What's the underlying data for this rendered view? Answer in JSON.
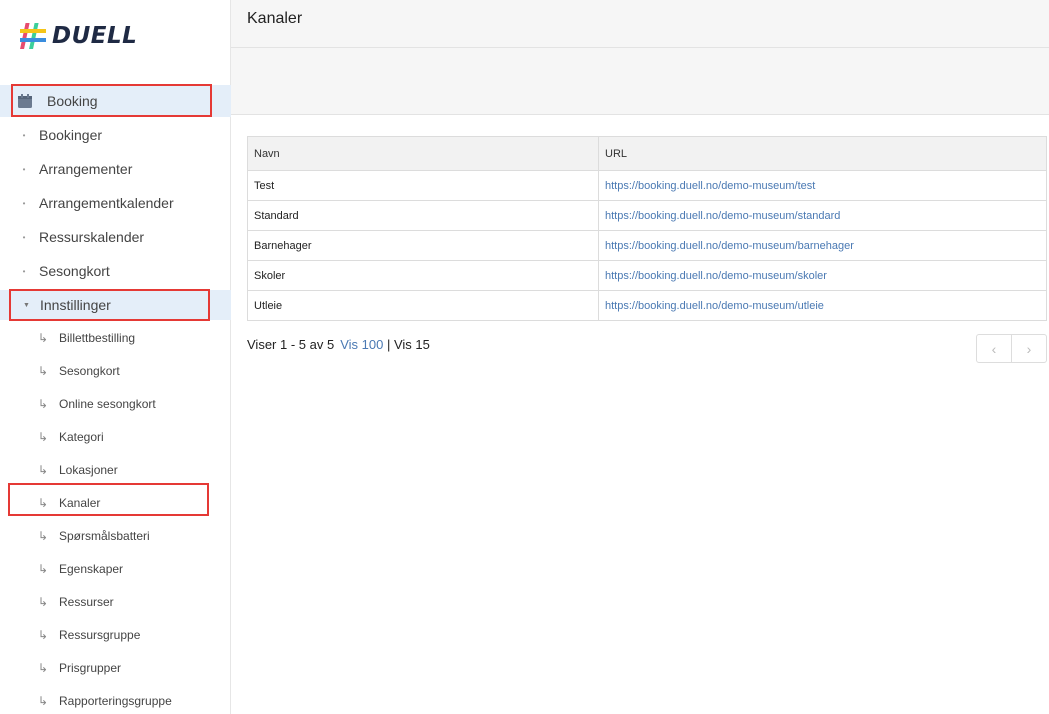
{
  "app": {
    "logo_text": "DUELL"
  },
  "sidebar": {
    "booking_label": "Booking",
    "items": [
      {
        "label": "Bookinger"
      },
      {
        "label": "Arrangementer"
      },
      {
        "label": "Arrangementkalender"
      },
      {
        "label": "Ressurskalender"
      },
      {
        "label": "Sesongkort"
      }
    ],
    "settings_label": "Innstillinger",
    "sub_items": [
      {
        "label": "Billettbestilling"
      },
      {
        "label": "Sesongkort"
      },
      {
        "label": "Online sesongkort"
      },
      {
        "label": "Kategori"
      },
      {
        "label": "Lokasjoner"
      },
      {
        "label": "Kanaler"
      },
      {
        "label": "Spørsmålsbatteri"
      },
      {
        "label": "Egenskaper"
      },
      {
        "label": "Ressurser"
      },
      {
        "label": "Ressursgruppe"
      },
      {
        "label": "Prisgrupper"
      },
      {
        "label": "Rapporteringsgruppe"
      }
    ],
    "sub_arrow": "↳"
  },
  "header": {
    "title": "Kanaler"
  },
  "table": {
    "columns": [
      "Navn",
      "URL"
    ],
    "rows": [
      {
        "name": "Test",
        "url": "https://booking.duell.no/demo-museum/test"
      },
      {
        "name": "Standard",
        "url": "https://booking.duell.no/demo-museum/standard"
      },
      {
        "name": "Barnehager",
        "url": "https://booking.duell.no/demo-museum/barnehager"
      },
      {
        "name": "Skoler",
        "url": "https://booking.duell.no/demo-museum/skoler"
      },
      {
        "name": "Utleie",
        "url": "https://booking.duell.no/demo-museum/utleie"
      }
    ]
  },
  "pager": {
    "info": "Viser 1 - 5 av 5",
    "vis100": "Vis 100",
    "separator": "|",
    "vis15": "Vis 15",
    "prev": "‹",
    "next": "›"
  },
  "colors": {
    "accent": "#4a79b3",
    "highlight": "#e53935",
    "active_bg": "#e4eef9"
  }
}
